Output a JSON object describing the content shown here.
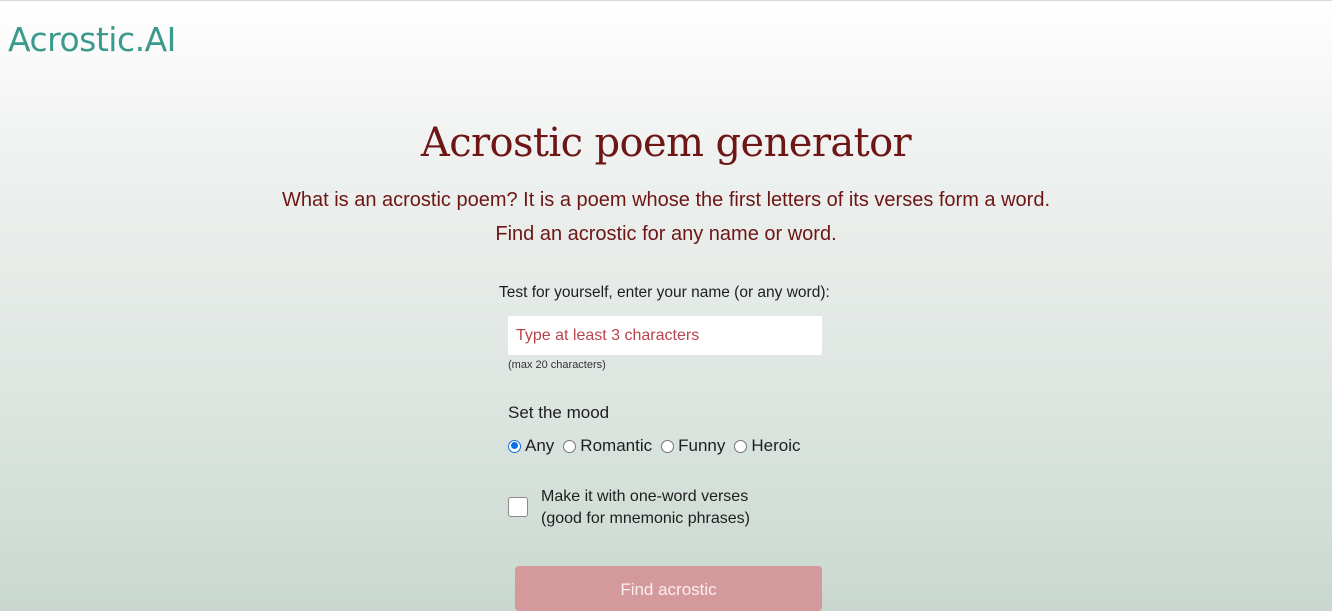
{
  "header": {
    "logo_text": "Acrostic.AI",
    "brand_color": "#3a9a8c"
  },
  "main": {
    "title": "Acrostic poem generator",
    "subtitle_line1": "What is an acrostic poem? It is a poem whose the first letters of its verses form a word.",
    "subtitle_line2": "Find an acrostic for any name or word.",
    "title_color": "#6e1515"
  },
  "form": {
    "prompt_label": "Test for yourself, enter your name (or any word):",
    "name_input": {
      "value": "",
      "placeholder": "Type at least 3 characters"
    },
    "max_hint": "(max 20 characters)",
    "mood": {
      "label": "Set the mood",
      "options": [
        {
          "label": "Any",
          "checked": true
        },
        {
          "label": "Romantic",
          "checked": false
        },
        {
          "label": "Funny",
          "checked": false
        },
        {
          "label": "Heroic",
          "checked": false
        }
      ],
      "selected": "Any"
    },
    "one_word_checkbox": {
      "checked": false,
      "label_line1": "Make it with one-word verses",
      "label_line2": "(good for mnemonic phrases)"
    },
    "submit_button": {
      "label": "Find acrostic",
      "color": "#d4999b"
    }
  }
}
